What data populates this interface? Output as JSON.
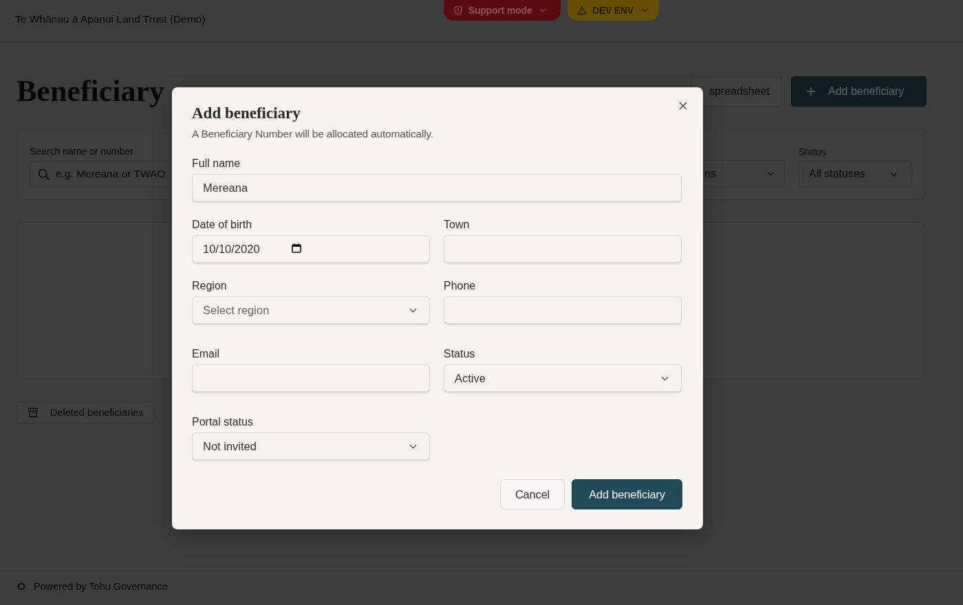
{
  "header": {
    "org_name": "Te Whānau ā Apanui Land Trust (Demo)",
    "badges": [
      {
        "kind": "support",
        "label": "Support mode"
      },
      {
        "kind": "env",
        "label": "DEV ENV"
      }
    ]
  },
  "page": {
    "title": "Beneficiary",
    "actions": [
      {
        "kind": "outline",
        "label": "spreadsheet"
      },
      {
        "kind": "primary",
        "label": "Add beneficiary"
      }
    ]
  },
  "filters": {
    "search": {
      "label": "Search name or number",
      "placeholder": "e.g. Mereana or TWAO"
    },
    "dropdowns": [
      {
        "value": "ns"
      },
      {
        "label": "Status",
        "value": "All statuses"
      }
    ]
  },
  "deleted_link": {
    "label": "Deleted beneficiaries"
  },
  "footer": {
    "text": "Powered by Tohu Governance"
  },
  "dialog": {
    "title": "Add beneficiary",
    "subtitle": "A Beneficiary Number will be allocated automatically.",
    "fields": [
      {
        "kind": "text",
        "label": "Full name",
        "value": "Mereana",
        "full_width": true
      },
      {
        "kind": "date",
        "label": "Date of birth",
        "value": "10/10/2020",
        "full_width": false
      },
      {
        "kind": "text",
        "label": "Town",
        "full_width": false
      },
      {
        "kind": "select",
        "label": "Region",
        "placeholder": "Select region",
        "full_width": false
      },
      {
        "kind": "text",
        "label": "Phone",
        "full_width": false
      },
      {
        "kind": "text",
        "label": "Email",
        "full_width": false
      },
      {
        "kind": "select",
        "label": "Status",
        "value": "Active",
        "full_width": false
      },
      {
        "kind": "select",
        "label": "Portal status",
        "value": "Not invited",
        "full_width": false
      }
    ],
    "buttons": [
      {
        "kind": "cancel",
        "label": "Cancel"
      },
      {
        "kind": "submit",
        "label": "Add beneficiary"
      }
    ]
  }
}
